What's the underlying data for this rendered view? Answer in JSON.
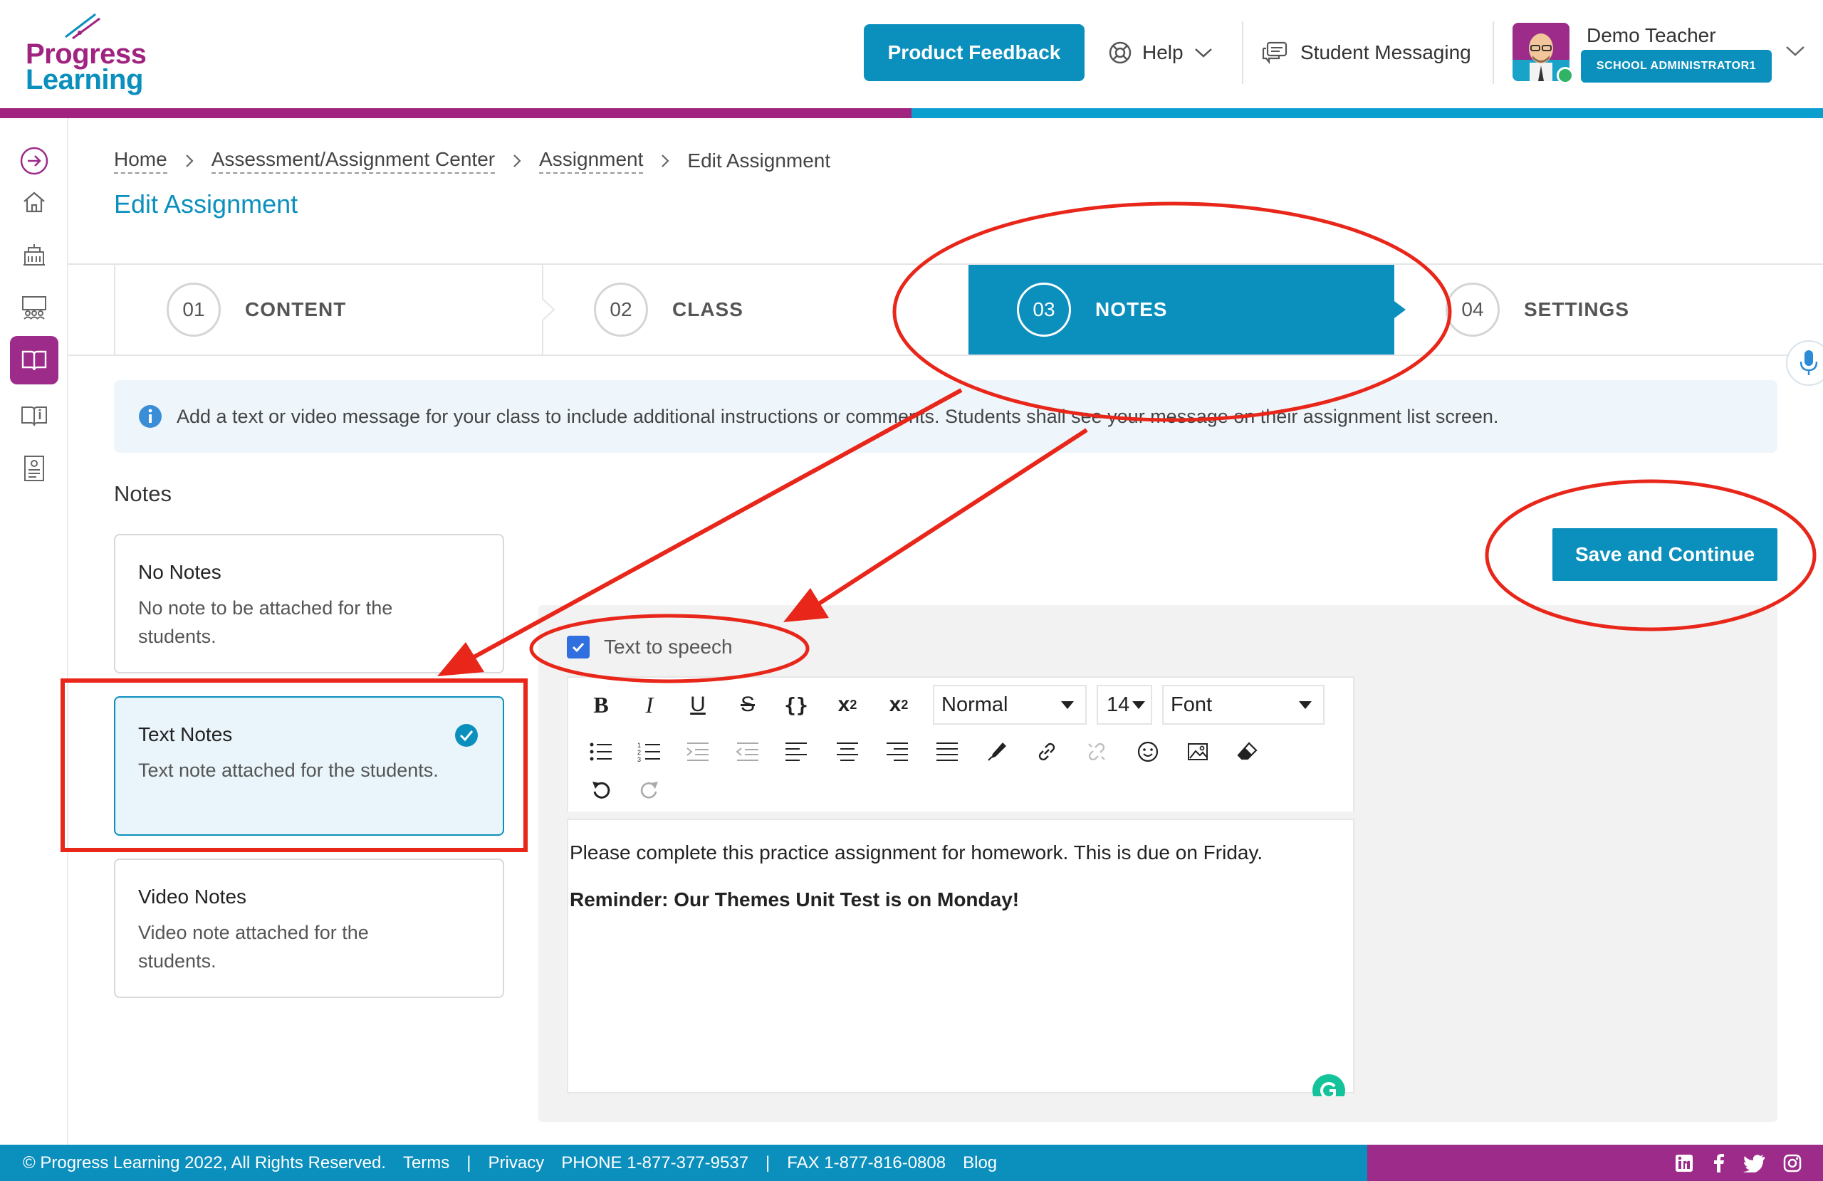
{
  "brand": {
    "logo_word1": "Progress",
    "logo_word2": "Learning",
    "colors": {
      "primary": "#0b8fbd",
      "secondary": "#9c2b8a",
      "annotation": "#e8261a"
    }
  },
  "header": {
    "feedback_label": "Product Feedback",
    "help_label": "Help",
    "messaging_label": "Student Messaging",
    "user_name": "Demo Teacher",
    "user_role": "SCHOOL ADMINISTRATOR1"
  },
  "sidebar": {
    "items": [
      {
        "icon": "expand-arrow-icon"
      },
      {
        "icon": "home-icon"
      },
      {
        "icon": "school-icon"
      },
      {
        "icon": "classroom-icon"
      },
      {
        "icon": "book-open-icon",
        "active": true
      },
      {
        "icon": "library-icon"
      },
      {
        "icon": "report-icon"
      }
    ]
  },
  "breadcrumb": [
    "Home",
    "Assessment/Assignment Center",
    "Assignment",
    "Edit Assignment"
  ],
  "page_title": "Edit Assignment",
  "steps": [
    {
      "num": "01",
      "label": "CONTENT"
    },
    {
      "num": "02",
      "label": "CLASS"
    },
    {
      "num": "03",
      "label": "NOTES",
      "active": true
    },
    {
      "num": "04",
      "label": "SETTINGS"
    }
  ],
  "info_text": "Add a text or video message for your class to include additional instructions or comments. Students shall see your message on their assignment list screen.",
  "notes": {
    "heading": "Notes",
    "options": [
      {
        "title": "No Notes",
        "desc": "No note to be attached for the students."
      },
      {
        "title": "Text Notes",
        "desc": "Text note attached for the students.",
        "selected": true
      },
      {
        "title": "Video Notes",
        "desc": "Video note attached for the students."
      }
    ]
  },
  "save_label": "Save and Continue",
  "tts_label": "Text to speech",
  "tts_checked": true,
  "toolbar": {
    "format_value": "Normal",
    "size_value": "14",
    "font_value": "Font"
  },
  "editor": {
    "line1": "Please complete this practice assignment for homework.  This is due on Friday.",
    "line2": "Reminder:  Our Themes Unit Test is on Monday!"
  },
  "footer": {
    "copyright": "© Progress Learning 2022, All Rights Reserved.",
    "terms": "Terms",
    "sep": "|",
    "privacy": "Privacy",
    "phone": "PHONE 1-877-377-9537",
    "fax": "FAX 1-877-816-0808",
    "blog": "Blog",
    "social": [
      "linkedin-icon",
      "facebook-icon",
      "twitter-icon",
      "instagram-icon"
    ]
  }
}
